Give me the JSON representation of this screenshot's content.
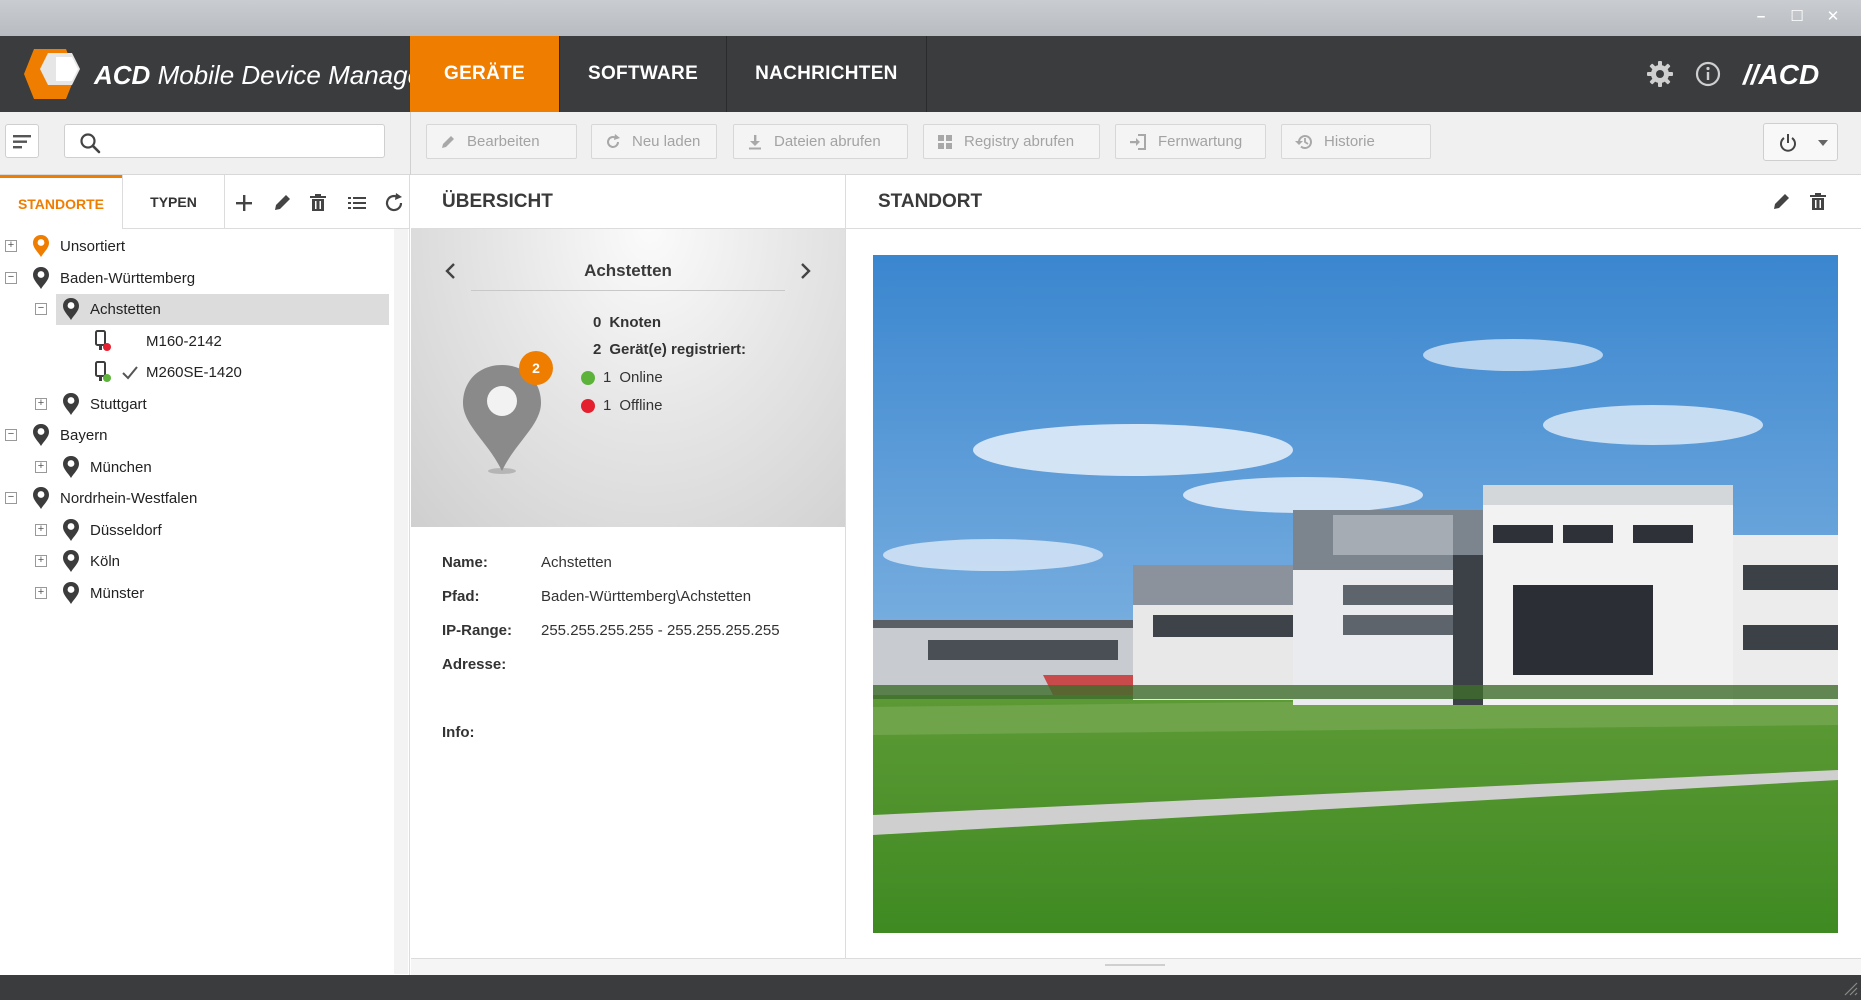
{
  "window": {
    "controls": [
      "–",
      "☐",
      "✕"
    ]
  },
  "header": {
    "title_bold": "ACD",
    "title_rest": " Mobile Device Manager",
    "nav_tabs": [
      {
        "label": "GERÄTE",
        "active": true
      },
      {
        "label": "SOFTWARE",
        "active": false
      },
      {
        "label": "NACHRICHTEN",
        "active": false
      }
    ],
    "brand_text": "//ACD",
    "accent_color": "#ef7d00"
  },
  "toolbar": {
    "search_placeholder": "",
    "buttons": [
      {
        "label": "Bearbeiten",
        "icon": "pencil-icon"
      },
      {
        "label": "Neu laden",
        "icon": "refresh-icon"
      },
      {
        "label": "Dateien abrufen",
        "icon": "download-icon"
      },
      {
        "label": "Registry abrufen",
        "icon": "registry-icon"
      },
      {
        "label": "Fernwartung",
        "icon": "remote-login-icon"
      },
      {
        "label": "Historie",
        "icon": "history-icon"
      }
    ]
  },
  "left": {
    "tabs": [
      {
        "label": "STANDORTE",
        "active": true
      },
      {
        "label": "TYPEN",
        "active": false
      }
    ],
    "tree": [
      {
        "label": "Unsortiert",
        "level": 0,
        "expander": "+",
        "icon": "pin-orange"
      },
      {
        "label": "Baden-Württemberg",
        "level": 0,
        "expander": "−",
        "icon": "pin"
      },
      {
        "label": "Achstetten",
        "level": 1,
        "expander": "−",
        "icon": "pin",
        "selected": true
      },
      {
        "label": "M160-2142",
        "level": 2,
        "icon": "device-offline"
      },
      {
        "label": "M260SE-1420",
        "level": 2,
        "icon": "device-online",
        "checked": true
      },
      {
        "label": "Stuttgart",
        "level": 1,
        "expander": "+",
        "icon": "pin"
      },
      {
        "label": "Bayern",
        "level": 0,
        "expander": "−",
        "icon": "pin"
      },
      {
        "label": "München",
        "level": 1,
        "expander": "+",
        "icon": "pin"
      },
      {
        "label": "Nordrhein-Westfalen",
        "level": 0,
        "expander": "−",
        "icon": "pin"
      },
      {
        "label": "Düsseldorf",
        "level": 1,
        "expander": "+",
        "icon": "pin"
      },
      {
        "label": "Köln",
        "level": 1,
        "expander": "+",
        "icon": "pin"
      },
      {
        "label": "Münster",
        "level": 1,
        "expander": "+",
        "icon": "pin"
      }
    ]
  },
  "overview": {
    "heading": "ÜBERSICHT",
    "location": "Achstetten",
    "badge_count": "2",
    "knoten": {
      "count": "0",
      "label": "Knoten"
    },
    "registered": {
      "count": "2",
      "label": "Gerät(e) registriert:"
    },
    "online": {
      "count": "1",
      "label": "Online",
      "color": "#5db33a"
    },
    "offline": {
      "count": "1",
      "label": "Offline",
      "color": "#e5202e"
    },
    "details": [
      {
        "key": "Name:",
        "value": "Achstetten"
      },
      {
        "key": "Pfad:",
        "value": "Baden-Württemberg\\Achstetten"
      },
      {
        "key": "IP-Range:",
        "value": "255.255.255.255 - 255.255.255.255"
      },
      {
        "key": "Adresse:",
        "value": ""
      },
      {
        "key": "Info:",
        "value": ""
      }
    ]
  },
  "standort": {
    "heading": "STANDORT",
    "photo_subject": "building-photo"
  }
}
